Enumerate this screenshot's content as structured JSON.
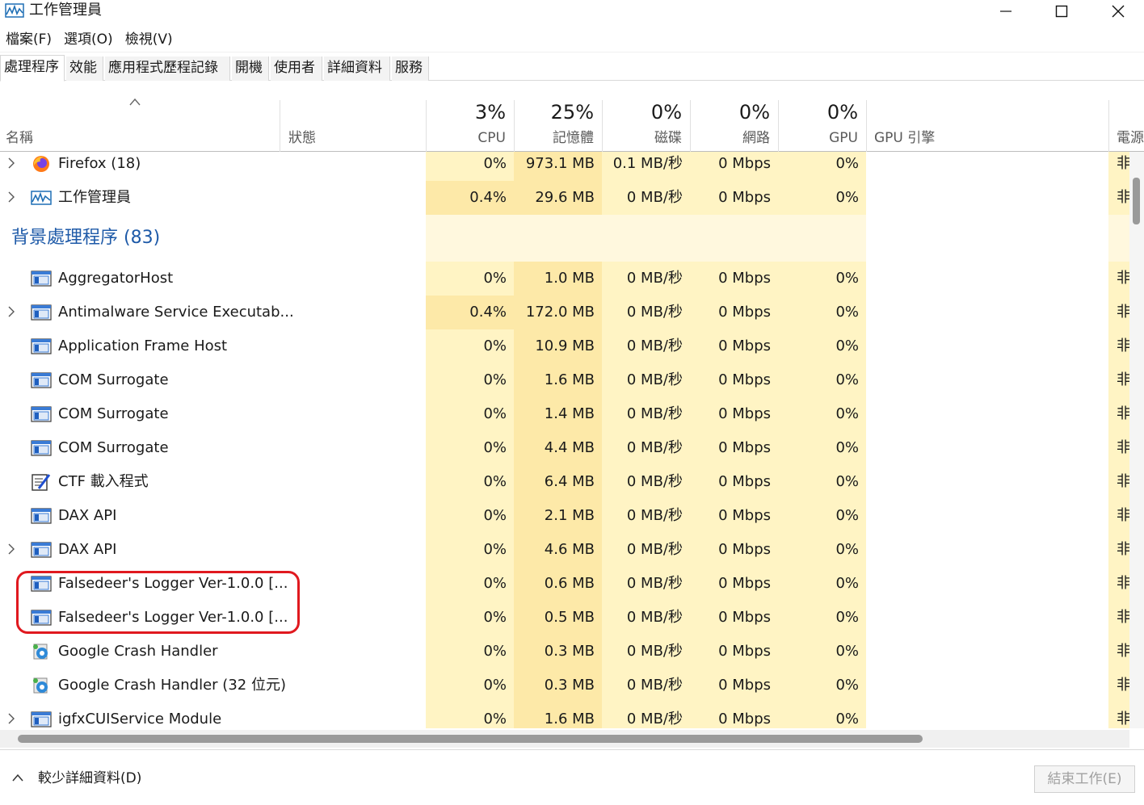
{
  "window": {
    "title": "工作管理員",
    "min_icon": "minimize-icon",
    "max_icon": "maximize-icon",
    "close_icon": "close-icon"
  },
  "menu": [
    "檔案(F)",
    "選項(O)",
    "檢視(V)"
  ],
  "tabs": [
    "處理程序",
    "效能",
    "應用程式歷程記錄",
    "開機",
    "使用者",
    "詳細資料",
    "服務"
  ],
  "header": {
    "name": "名稱",
    "status": "狀態",
    "cpu": {
      "pct": "3%",
      "label": "CPU"
    },
    "memory": {
      "pct": "25%",
      "label": "記憶體"
    },
    "disk": {
      "pct": "0%",
      "label": "磁碟"
    },
    "network": {
      "pct": "0%",
      "label": "網路"
    },
    "gpu": {
      "pct": "0%",
      "label": "GPU"
    },
    "gpu_engine": "GPU 引擎",
    "power": "電源"
  },
  "colors": {
    "cpu_bg": "#fff4c4",
    "cpu_bg_high": "#fde9a8",
    "mem_bg": "#fde9a8",
    "col_bg": "#fff4c4",
    "group_text": "#1e5aa8",
    "highlight": "#e0191f"
  },
  "apps": [
    {
      "name": "Firefox (18)",
      "icon": "firefox-icon",
      "expandable": true,
      "cpu": "0%",
      "memory": "973.1 MB",
      "disk": "0.1 MB/秒",
      "network": "0 Mbps",
      "gpu": "0%",
      "power": "非"
    },
    {
      "name": "工作管理員",
      "icon": "task-manager-icon",
      "expandable": true,
      "cpu": "0.4%",
      "memory": "29.6 MB",
      "disk": "0 MB/秒",
      "network": "0 Mbps",
      "gpu": "0%",
      "power": "非"
    }
  ],
  "background_group": {
    "label": "背景處理程序 (83)"
  },
  "background": [
    {
      "name": "AggregatorHost",
      "icon": "app-window-icon",
      "expandable": false,
      "cpu": "0%",
      "memory": "1.0 MB",
      "disk": "0 MB/秒",
      "network": "0 Mbps",
      "gpu": "0%",
      "power": "非"
    },
    {
      "name": "Antimalware Service Executab...",
      "icon": "app-window-icon",
      "expandable": true,
      "cpu": "0.4%",
      "memory": "172.0 MB",
      "disk": "0 MB/秒",
      "network": "0 Mbps",
      "gpu": "0%",
      "power": "非"
    },
    {
      "name": "Application Frame Host",
      "icon": "app-window-icon",
      "expandable": false,
      "cpu": "0%",
      "memory": "10.9 MB",
      "disk": "0 MB/秒",
      "network": "0 Mbps",
      "gpu": "0%",
      "power": "非"
    },
    {
      "name": "COM Surrogate",
      "icon": "app-window-icon",
      "expandable": false,
      "cpu": "0%",
      "memory": "1.6 MB",
      "disk": "0 MB/秒",
      "network": "0 Mbps",
      "gpu": "0%",
      "power": "非"
    },
    {
      "name": "COM Surrogate",
      "icon": "app-window-icon",
      "expandable": false,
      "cpu": "0%",
      "memory": "1.4 MB",
      "disk": "0 MB/秒",
      "network": "0 Mbps",
      "gpu": "0%",
      "power": "非"
    },
    {
      "name": "COM Surrogate",
      "icon": "app-window-icon",
      "expandable": false,
      "cpu": "0%",
      "memory": "4.4 MB",
      "disk": "0 MB/秒",
      "network": "0 Mbps",
      "gpu": "0%",
      "power": "非"
    },
    {
      "name": "CTF 載入程式",
      "icon": "ctf-loader-icon",
      "expandable": false,
      "cpu": "0%",
      "memory": "6.4 MB",
      "disk": "0 MB/秒",
      "network": "0 Mbps",
      "gpu": "0%",
      "power": "非"
    },
    {
      "name": "DAX API",
      "icon": "app-window-icon",
      "expandable": false,
      "cpu": "0%",
      "memory": "2.1 MB",
      "disk": "0 MB/秒",
      "network": "0 Mbps",
      "gpu": "0%",
      "power": "非"
    },
    {
      "name": "DAX API",
      "icon": "app-window-icon",
      "expandable": true,
      "cpu": "0%",
      "memory": "4.6 MB",
      "disk": "0 MB/秒",
      "network": "0 Mbps",
      "gpu": "0%",
      "power": "非"
    },
    {
      "name": "Falsedeer's Logger Ver-1.0.0 [...",
      "icon": "app-window-icon",
      "expandable": false,
      "cpu": "0%",
      "memory": "0.6 MB",
      "disk": "0 MB/秒",
      "network": "0 Mbps",
      "gpu": "0%",
      "power": "非"
    },
    {
      "name": "Falsedeer's Logger Ver-1.0.0 [...",
      "icon": "app-window-icon",
      "expandable": false,
      "cpu": "0%",
      "memory": "0.5 MB",
      "disk": "0 MB/秒",
      "network": "0 Mbps",
      "gpu": "0%",
      "power": "非"
    },
    {
      "name": "Google Crash Handler",
      "icon": "google-crash-handler-icon",
      "expandable": false,
      "cpu": "0%",
      "memory": "0.3 MB",
      "disk": "0 MB/秒",
      "network": "0 Mbps",
      "gpu": "0%",
      "power": "非"
    },
    {
      "name": "Google Crash Handler (32 位元)",
      "icon": "google-crash-handler-icon",
      "expandable": false,
      "cpu": "0%",
      "memory": "0.3 MB",
      "disk": "0 MB/秒",
      "network": "0 Mbps",
      "gpu": "0%",
      "power": "非"
    },
    {
      "name": "igfxCUIService Module",
      "icon": "app-window-icon",
      "expandable": true,
      "cpu": "0%",
      "memory": "1.6 MB",
      "disk": "0 MB/秒",
      "network": "0 Mbps",
      "gpu": "0%",
      "power": "非"
    }
  ],
  "footer": {
    "fewer_details": "較少詳細資料(D)",
    "end_task": "結束工作(E)"
  }
}
